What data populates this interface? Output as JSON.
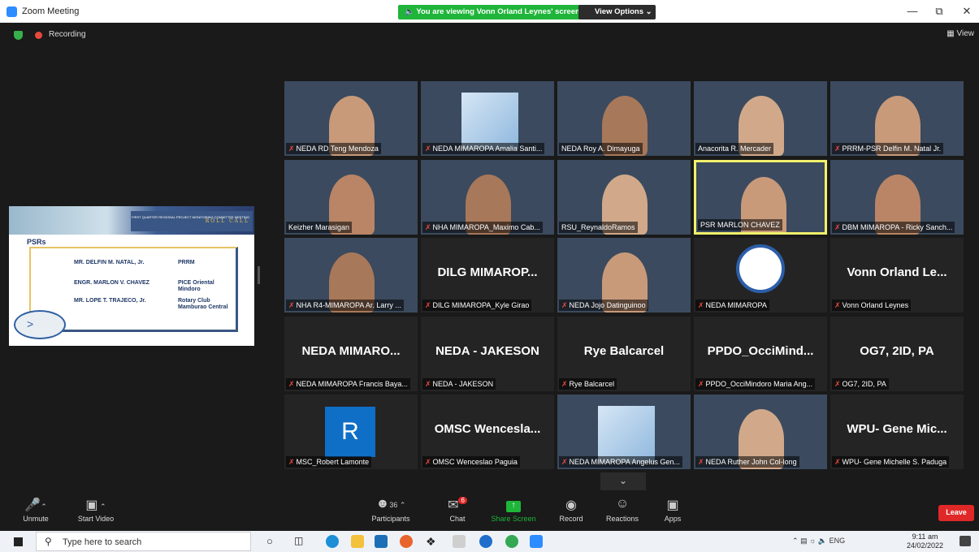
{
  "window": {
    "title": "Zoom Meeting",
    "share_banner": "You are viewing Vonn Orland Leynes' screen",
    "view_options": "View Options ⌄",
    "recording": "Recording",
    "view_button": "View",
    "minimize": "—",
    "maximize": "⧉",
    "close": "✕"
  },
  "shared_screen": {
    "slide_head": "FIRST QUARTER REGIONAL PROJECT MONITORING COMMITTEE MEETING",
    "roll_call": "ROLL CALL",
    "heading": "PSRs",
    "rows": [
      {
        "name": "MR. DELFIN M. NATAL, Jr.",
        "org": "PRRM"
      },
      {
        "name": "ENGR. MARLON V. CHAVEZ",
        "org": "PICE Oriental Mindoro"
      },
      {
        "name": "MR. LOPE T. TRAJECO, Jr.",
        "org": "Rotary Club Mamburao Central"
      }
    ]
  },
  "tiles": [
    {
      "label": "NEDA RD Teng Mendoza",
      "muted": true,
      "kind": "video"
    },
    {
      "label": "NEDA MIMAROPA Amalia Santi...",
      "muted": true,
      "kind": "slide"
    },
    {
      "label": "NEDA Roy A. Dimayuga",
      "muted": false,
      "kind": "video"
    },
    {
      "label": "Anacorita R. Mercader",
      "muted": false,
      "kind": "video"
    },
    {
      "label": "PRRM-PSR Delfin M. Natal Jr.",
      "muted": true,
      "kind": "video"
    },
    {
      "label": "Keizher Marasigan",
      "muted": false,
      "kind": "video"
    },
    {
      "label": "NHA MIMAROPA_Maximo Cab...",
      "muted": true,
      "kind": "video"
    },
    {
      "label": "RSU_ReynaldoRamos",
      "muted": false,
      "kind": "video"
    },
    {
      "label": "PSR MARLON CHAVEZ",
      "muted": false,
      "kind": "video",
      "active": true
    },
    {
      "label": "DBM MIMAROPA - Ricky Sanch...",
      "muted": true,
      "kind": "video"
    },
    {
      "label": "NHA R4-MIMAROPA Ar. Larry ...",
      "muted": true,
      "kind": "video"
    },
    {
      "label": "DILG MIMAROPA_Kyle Girao",
      "muted": true,
      "kind": "name",
      "big": "DILG MIMAROP..."
    },
    {
      "label": "NEDA Jojo Datinguinoo",
      "muted": true,
      "kind": "video"
    },
    {
      "label": "NEDA MIMAROPA",
      "muted": true,
      "kind": "logo"
    },
    {
      "label": "Vonn Orland Leynes",
      "muted": true,
      "kind": "name",
      "big": "Vonn Orland Le..."
    },
    {
      "label": "NEDA MIMAROPA Francis Baya...",
      "muted": true,
      "kind": "name",
      "big": "NEDA MIMARO..."
    },
    {
      "label": "NEDA - JAKESON",
      "muted": true,
      "kind": "name",
      "big": "NEDA - JAKESON"
    },
    {
      "label": "Rye Balcarcel",
      "muted": true,
      "kind": "name",
      "big": "Rye Balcarcel"
    },
    {
      "label": "PPDO_OcciMindoro Maria Ang...",
      "muted": true,
      "kind": "name",
      "big": "PPDO_OcciMind..."
    },
    {
      "label": "OG7, 2ID, PA",
      "muted": true,
      "kind": "name",
      "big": "OG7, 2ID, PA"
    },
    {
      "label": "MSC_Robert Lamonte",
      "muted": true,
      "kind": "avatar",
      "avatar": "R"
    },
    {
      "label": "OMSC Wenceslao Paguia",
      "muted": true,
      "kind": "name",
      "big": "OMSC Wencesla..."
    },
    {
      "label": "NEDA MIMAROPA Angelus Gen...",
      "muted": true,
      "kind": "slide"
    },
    {
      "label": "NEDA Ruther John Col-long",
      "muted": true,
      "kind": "video"
    },
    {
      "label": "WPU- Gene Michelle S. Paduga",
      "muted": true,
      "kind": "name",
      "big": "WPU- Gene Mic..."
    }
  ],
  "toolbar": {
    "unmute": "Unmute",
    "start_video": "Start Video",
    "participants": "Participants",
    "participants_count": "36",
    "chat": "Chat",
    "chat_badge": "6",
    "share_screen": "Share Screen",
    "record": "Record",
    "reactions": "Reactions",
    "apps": "Apps",
    "leave": "Leave",
    "colors": {
      "share": "#1fb53a",
      "leave": "#e02828"
    }
  },
  "taskbar": {
    "search_placeholder": "Type here to search",
    "lang": "ENG",
    "time": "9:11 am",
    "date": "24/02/2022"
  }
}
